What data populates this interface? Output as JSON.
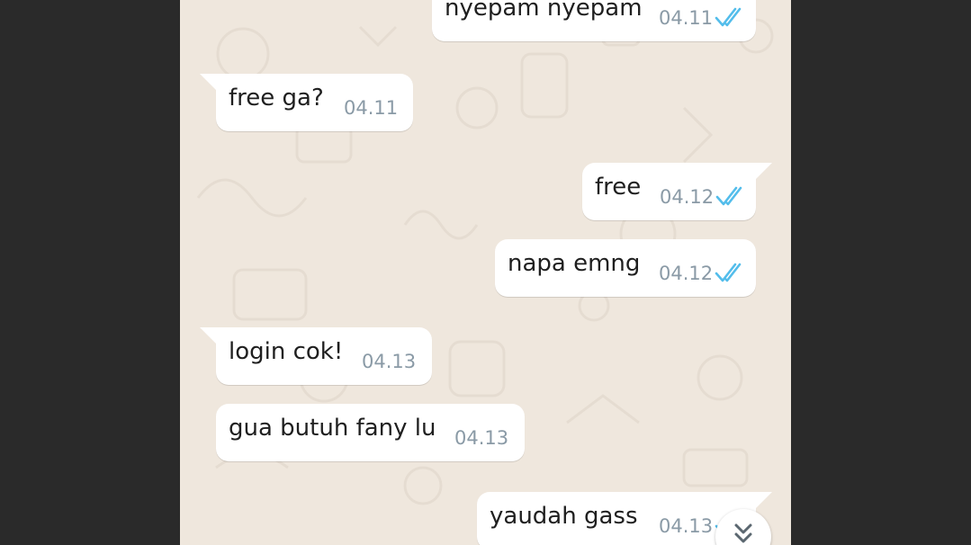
{
  "chat": {
    "messages": [
      {
        "text": "nyepam nyepam",
        "time": "04.11",
        "dir": "out",
        "status": "read"
      },
      {
        "text": "free ga?",
        "time": "04.11",
        "dir": "in"
      },
      {
        "text": "free",
        "time": "04.12",
        "dir": "out",
        "status": "read"
      },
      {
        "text": "napa emng",
        "time": "04.12",
        "dir": "out",
        "status": "read"
      },
      {
        "text": "login cok!",
        "time": "04.13",
        "dir": "in"
      },
      {
        "text": "gua butuh fany lu",
        "time": "04.13",
        "dir": "in"
      },
      {
        "text": "yaudah gass",
        "time": "04.13",
        "dir": "out",
        "status": "read"
      }
    ]
  },
  "scroll_button": {
    "icon": "double-chevron-down-icon"
  },
  "colors": {
    "background": "#efe7dd",
    "bubble": "#ffffff",
    "read_tick": "#53bdeb",
    "timestamp": "#8a9aa6"
  }
}
